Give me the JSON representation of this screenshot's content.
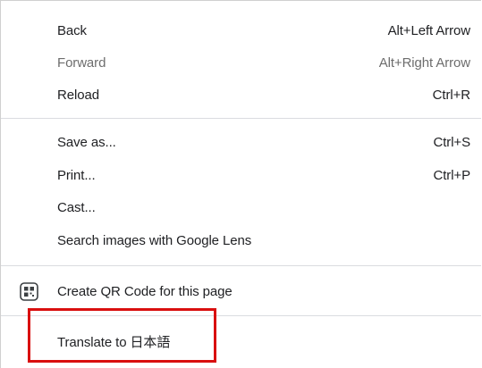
{
  "menu": {
    "items": [
      {
        "label": "Back",
        "shortcut": "Alt+Left Arrow",
        "enabled": true
      },
      {
        "label": "Forward",
        "shortcut": "Alt+Right Arrow",
        "enabled": false
      },
      {
        "label": "Reload",
        "shortcut": "Ctrl+R",
        "enabled": true
      },
      {
        "label": "Save as...",
        "shortcut": "Ctrl+S",
        "enabled": true
      },
      {
        "label": "Print...",
        "shortcut": "Ctrl+P",
        "enabled": true
      },
      {
        "label": "Cast...",
        "shortcut": "",
        "enabled": true
      },
      {
        "label": "Search images with Google Lens",
        "shortcut": "",
        "enabled": true
      },
      {
        "label": "Create QR Code for this page",
        "shortcut": "",
        "icon": "qr-code-icon",
        "enabled": true
      },
      {
        "label": "Translate to 日本語",
        "shortcut": "",
        "enabled": true
      }
    ]
  },
  "annotation": {
    "highlight_color": "#d90f0f",
    "highlighted_item": "Translate to 日本語"
  }
}
